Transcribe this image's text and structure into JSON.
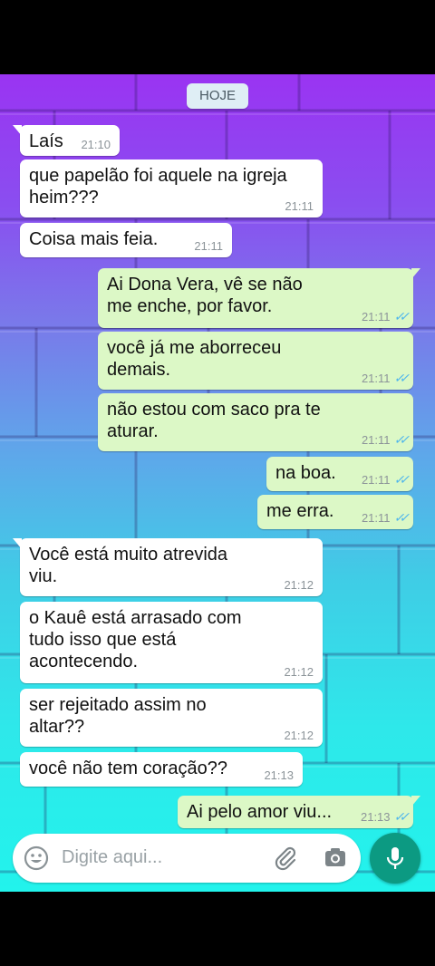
{
  "date_chip": "HOJE",
  "composer": {
    "placeholder": "Digite aqui...",
    "emoji_icon": "smiley-icon",
    "attach_icon": "paperclip-icon",
    "camera_icon": "camera-icon",
    "mic_icon": "microphone-icon"
  },
  "colors": {
    "incoming_bubble": "#ffffff",
    "outgoing_bubble": "#dcf8c6",
    "read_ticks": "#4fb6ec",
    "mic_button": "#0c9a82"
  },
  "messages": [
    {
      "dir": "in",
      "text": "Laís",
      "time": "21:10"
    },
    {
      "dir": "in",
      "text": "que papelão foi aquele na igreja heim???",
      "time": "21:11"
    },
    {
      "dir": "in",
      "text": "Coisa mais feia.",
      "time": "21:11"
    },
    {
      "dir": "out",
      "text": "Ai Dona Vera, vê se não me enche, por favor.",
      "time": "21:11"
    },
    {
      "dir": "out",
      "text": "você já me aborreceu demais.",
      "time": "21:11"
    },
    {
      "dir": "out",
      "text": "não estou com saco pra te aturar.",
      "time": "21:11"
    },
    {
      "dir": "out",
      "text": "na boa.",
      "time": "21:11"
    },
    {
      "dir": "out",
      "text": "me erra.",
      "time": "21:11"
    },
    {
      "dir": "in",
      "text": "Você está muito atrevida viu.",
      "time": "21:12"
    },
    {
      "dir": "in",
      "text": "o Kauê está arrasado com tudo isso que está acontecendo.",
      "time": "21:12"
    },
    {
      "dir": "in",
      "text": "ser rejeitado assim no altar??",
      "time": "21:12"
    },
    {
      "dir": "in",
      "text": "você não tem coração??",
      "time": "21:13"
    },
    {
      "dir": "out",
      "text": "Ai pelo amor viu...",
      "time": "21:13"
    }
  ]
}
